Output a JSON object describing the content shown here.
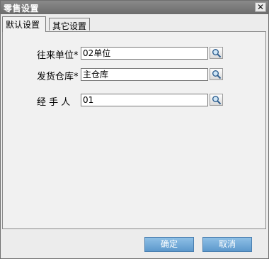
{
  "window": {
    "title": "零售设置",
    "close_glyph": "✕"
  },
  "tabs": [
    {
      "label": "默认设置",
      "active": true
    },
    {
      "label": "其它设置",
      "active": false
    }
  ],
  "form": {
    "fields": [
      {
        "label": "往来单位*",
        "value": "02单位"
      },
      {
        "label": "发货仓库*",
        "value": "主仓库"
      },
      {
        "label": "经 手 人",
        "value": "01"
      }
    ],
    "lookup_icon": "search-icon"
  },
  "buttons": {
    "ok": "确定",
    "cancel": "取消"
  },
  "colors": {
    "titlebar": "#7a7a7a",
    "button": "#6ea6d6"
  }
}
